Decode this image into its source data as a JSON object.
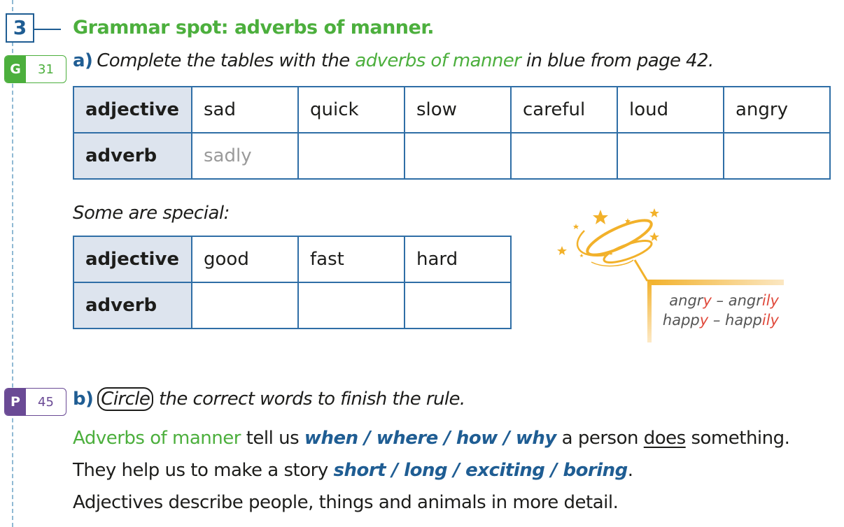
{
  "exercise": {
    "number": "3",
    "title": "Grammar spot: adverbs of manner."
  },
  "part_a": {
    "badge": {
      "letter": "G",
      "number": "31"
    },
    "label": "a)",
    "instruction_pre": "Complete the tables with the ",
    "instruction_highlight": "adverbs of manner",
    "instruction_post": " in blue from page 42.",
    "table1": {
      "row_headers": [
        "adjective",
        "adverb"
      ],
      "adjectives": [
        "sad",
        "quick",
        "slow",
        "careful",
        "loud",
        "angry"
      ],
      "adverbs": [
        "sadly",
        "",
        "",
        "",
        "",
        ""
      ]
    },
    "special_label": "Some are special:",
    "table2": {
      "row_headers": [
        "adjective",
        "adverb"
      ],
      "adjectives": [
        "good",
        "fast",
        "hard"
      ],
      "adverbs": [
        "",
        "",
        ""
      ]
    },
    "spelling_rule": [
      {
        "base": "angr",
        "base_end": "y",
        "dash": " – ",
        "adv": "angr",
        "adv_end": "ily"
      },
      {
        "base": "happ",
        "base_end": "y",
        "dash": " – ",
        "adv": "happ",
        "adv_end": "ily"
      }
    ]
  },
  "part_b": {
    "badge": {
      "letter": "P",
      "number": "45"
    },
    "label": "b)",
    "instruction_circled": "Circle",
    "instruction_rest": " the correct words to finish the rule.",
    "sentence": {
      "term": "Adverbs of manner",
      "t1": " tell us ",
      "options1": "when / where / how / why",
      "t2": " a person ",
      "underlined": "does",
      "t3": " something. They help us to make a story ",
      "options2": "short / long / exciting / boring",
      "t4": ".",
      "line3": "Adjectives describe people, things and animals in more detail."
    }
  },
  "colors": {
    "green": "#4caf3d",
    "blue": "#1f5d93",
    "purple": "#6a4a95",
    "header_fill": "#dde4ee",
    "accent_red": "#e04a3c",
    "magic_gold": "#f2b12a"
  }
}
